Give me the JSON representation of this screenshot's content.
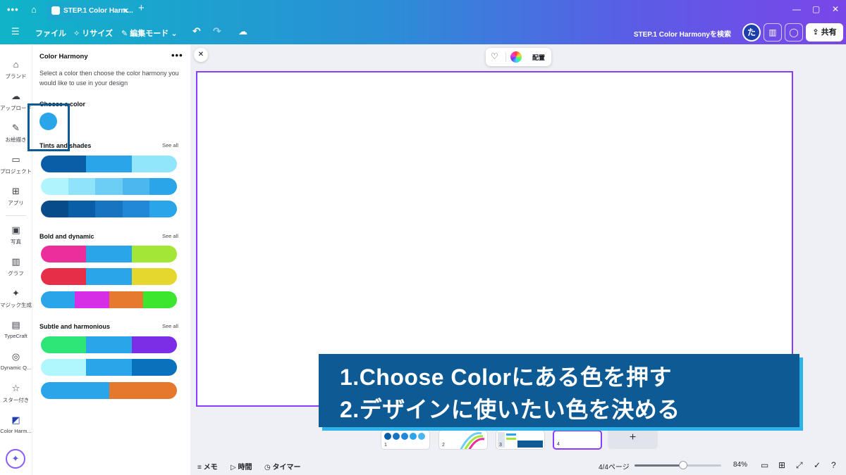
{
  "browser": {
    "tab_title": "STEP.1 Color Harm...",
    "menu_icon": "dots-icon",
    "home_icon": "home-icon",
    "close_tab": "✕",
    "new_tab": "+",
    "window_min": "—",
    "window_max": "▢",
    "window_close": "✕"
  },
  "menubar": {
    "hamburger": "☰",
    "file": "ファイル",
    "resize": "リサイズ",
    "edit_mode": "編集モード",
    "undo": "↶",
    "redo": "↷",
    "search": "STEP.1 Color Harmonyを検索",
    "avatar": "た",
    "share": "共有"
  },
  "rail": {
    "items": [
      {
        "label": "ブランド",
        "icon": "brand-icon",
        "glyph": "⌂"
      },
      {
        "label": "アップロード",
        "icon": "upload-icon",
        "glyph": "☁"
      },
      {
        "label": "お絵描き",
        "icon": "draw-icon",
        "glyph": "✎"
      },
      {
        "label": "プロジェクト",
        "icon": "folder-icon",
        "glyph": "▭"
      },
      {
        "label": "アプリ",
        "icon": "apps-icon",
        "glyph": "⊞"
      },
      {
        "label": "写真",
        "icon": "photo-icon",
        "glyph": "▣"
      },
      {
        "label": "グラフ",
        "icon": "chart-icon",
        "glyph": "▥"
      },
      {
        "label": "マジック生成",
        "icon": "magic-image-icon",
        "glyph": "✦"
      },
      {
        "label": "TypeCraft",
        "icon": "typecraft-icon",
        "glyph": "▤"
      },
      {
        "label": "Dynamic Q...",
        "icon": "dynamic-qr-icon",
        "glyph": "◎"
      },
      {
        "label": "スター付き",
        "icon": "star-icon",
        "glyph": "☆"
      },
      {
        "label": "Color Harm...",
        "icon": "color-harmony-icon",
        "glyph": "◩"
      }
    ],
    "magic_button": "✦"
  },
  "panel": {
    "title": "Color Harmony",
    "more": "•••",
    "description": "Select a color then choose the color harmony you would like to use in your design",
    "choose_label": "Choose a color",
    "chosen_color": "#2aa5ea",
    "sections": [
      {
        "title": "Tints and shades",
        "see_all": "See all",
        "palettes": [
          [
            "#0a5ea8",
            "#2aa5ea",
            "#92e6fc"
          ],
          [
            "#b0f4fd",
            "#8fe3fb",
            "#6ccdf5",
            "#4bb7ef",
            "#2aa5ea"
          ],
          [
            "#074b8a",
            "#0a5ea8",
            "#1774c0",
            "#2088d6",
            "#2aa5ea"
          ]
        ]
      },
      {
        "title": "Bold and dynamic",
        "see_all": "See all",
        "palettes": [
          [
            "#ea2e9a",
            "#2aa5ea",
            "#a3e635"
          ],
          [
            "#e62e48",
            "#2aa5ea",
            "#e6d72e"
          ],
          [
            "#2aa5ea",
            "#d62ee6",
            "#e67a2e",
            "#3de62e"
          ]
        ]
      },
      {
        "title": "Subtle and harmonious",
        "see_all": "See all",
        "palettes": [
          [
            "#2ee677",
            "#2aa5ea",
            "#7c2ee6"
          ],
          [
            "#b0f6fd",
            "#2aa5ea",
            "#0a72bd"
          ],
          [
            "#2aa5ea",
            "#e6782e"
          ]
        ]
      }
    ]
  },
  "canvas": {
    "close": "✕",
    "ctx_label": "配置",
    "ctx_icon": "magic-edit-icon"
  },
  "callout": {
    "line1": "1.Choose Colorにある色を押す",
    "line2": "2.デザインに使いたい色を決める"
  },
  "pages": {
    "thumbs": [
      "1",
      "2",
      "3",
      "4"
    ],
    "add": "+"
  },
  "footer": {
    "notes": "メモ",
    "time": "時間",
    "timer": "タイマー",
    "page_count": "4/4ページ",
    "zoom": "84%",
    "zoom_fraction": 0.56
  }
}
